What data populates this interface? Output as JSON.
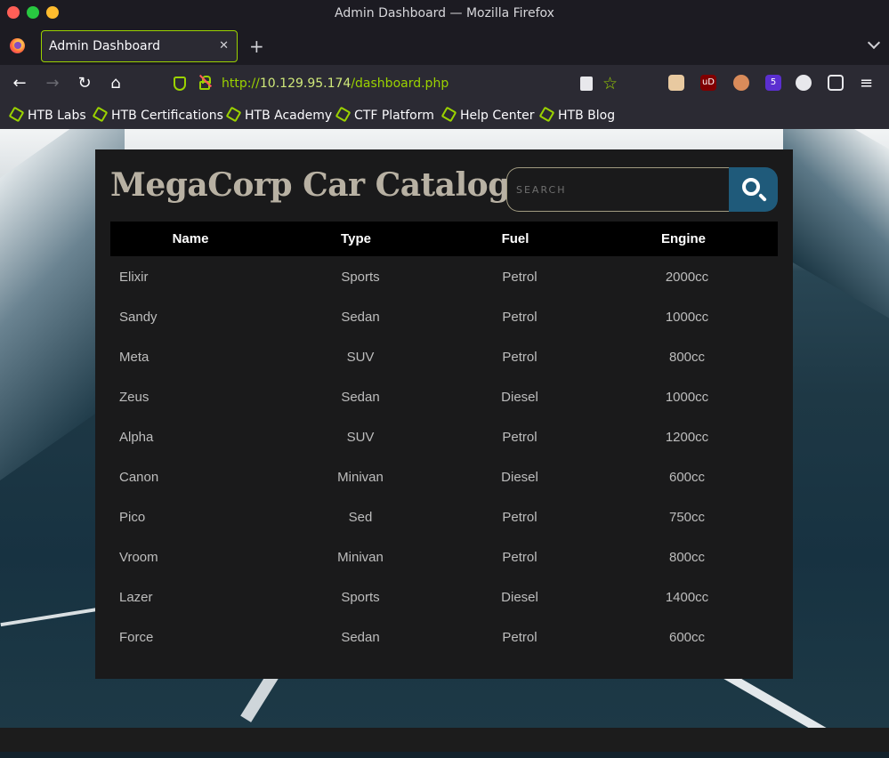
{
  "window": {
    "title": "Admin Dashboard — Mozilla Firefox"
  },
  "tabs": [
    {
      "title": "Admin Dashboard",
      "close": "✕"
    }
  ],
  "toolbar": {
    "new_tab": "+",
    "back": "←",
    "forward": "→",
    "reload": "↻",
    "home": "⌂",
    "menu": "≡",
    "star": "☆"
  },
  "address": {
    "scheme": "http://",
    "host": "10.129.95.174",
    "path": "/dashboard.php"
  },
  "extensions": [
    {
      "icon": "cookie-face-icon",
      "color": "#e8c9a0"
    },
    {
      "icon": "ublock-icon",
      "label": "uD",
      "color": "#800000"
    },
    {
      "icon": "cookie-stop-icon",
      "color": "#d98b5a"
    },
    {
      "icon": "hack-extension-icon",
      "label": "5",
      "color": "#5b2fd0"
    },
    {
      "icon": "cookie-icon",
      "color": "#e8e8ec"
    },
    {
      "icon": "puzzle-extensions-icon",
      "color": "#e8e8ec"
    }
  ],
  "bookmarks": [
    "HTB Labs",
    "HTB Certifications",
    "HTB Academy",
    "CTF Platform",
    "Help Center",
    "HTB Blog"
  ],
  "page": {
    "title": "MegaCorp Car Catalogue",
    "search_placeholder": "SEARCH"
  },
  "table": {
    "headers": [
      "Name",
      "Type",
      "Fuel",
      "Engine"
    ],
    "rows": [
      [
        "Elixir",
        "Sports",
        "Petrol",
        "2000cc"
      ],
      [
        "Sandy",
        "Sedan",
        "Petrol",
        "1000cc"
      ],
      [
        "Meta",
        "SUV",
        "Petrol",
        "800cc"
      ],
      [
        "Zeus",
        "Sedan",
        "Diesel",
        "1000cc"
      ],
      [
        "Alpha",
        "SUV",
        "Petrol",
        "1200cc"
      ],
      [
        "Canon",
        "Minivan",
        "Diesel",
        "600cc"
      ],
      [
        "Pico",
        "Sed",
        "Petrol",
        "750cc"
      ],
      [
        "Vroom",
        "Minivan",
        "Petrol",
        "800cc"
      ],
      [
        "Lazer",
        "Sports",
        "Diesel",
        "1400cc"
      ],
      [
        "Force",
        "Sedan",
        "Petrol",
        "600cc"
      ]
    ]
  },
  "colors": {
    "accent": "#9bd200",
    "search_button": "#1f5a7a",
    "panel": "#1a1a1b"
  }
}
